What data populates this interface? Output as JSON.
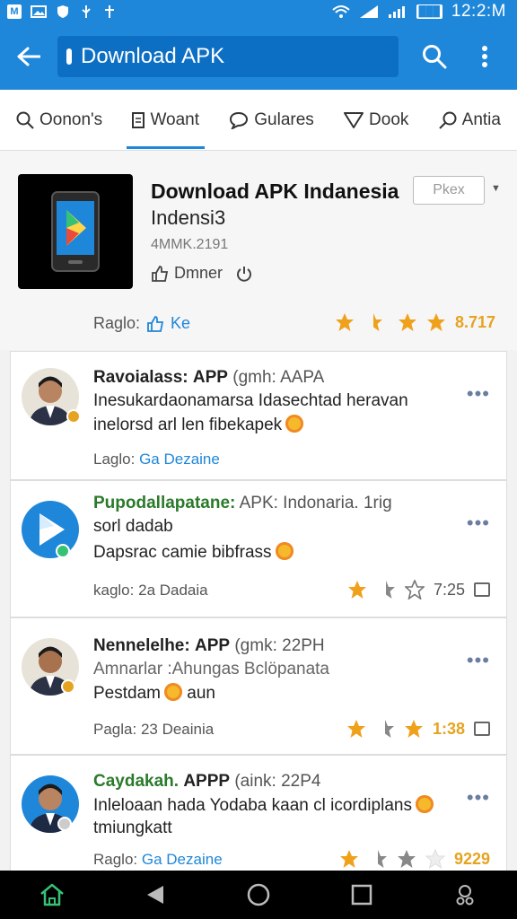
{
  "status_bar": {
    "left_icons": [
      "M",
      "img",
      "5",
      "usb",
      "+"
    ],
    "battery": "███",
    "time": "12:2:M"
  },
  "toolbar": {
    "search_text": "Download APK"
  },
  "tabs": [
    {
      "label": "Oonon's",
      "icon": "search-icon"
    },
    {
      "label": "Woant",
      "icon": "document-icon",
      "active": true
    },
    {
      "label": "Gulares",
      "icon": "chat-icon"
    },
    {
      "label": "Dook",
      "icon": "filter-icon"
    },
    {
      "label": "Antia",
      "icon": "search-icon"
    }
  ],
  "app": {
    "title": "Download APK Indanesia",
    "subtitle": "Indensi3",
    "date": "4MMK.2191",
    "action_label": "Dmner",
    "price_label": "Pkex",
    "rating_label": "Raglo:",
    "rating_value": "Ke",
    "score": "8.717",
    "accent_color": "#1f87d9",
    "star_color": "#f0a11c"
  },
  "posts": [
    {
      "author": "Ravoialass:",
      "app": "APP",
      "tag": "(gmh: AAPA",
      "line1": "Inesukardaonamarsa Idasechtad heravan",
      "line2": "inelorsd arl len fibekapek",
      "meta_label": "Laglo:",
      "meta_value": "Ga Dezaine"
    },
    {
      "author": "Pupodallapatane:",
      "app": "APK: Indonaria. 1rig",
      "tag": "",
      "line1": "sorl dadab",
      "line2": "Dapsrac camie bibfrass",
      "meta_label": "kaglo:",
      "meta_value": "2a Dadaia",
      "score": "7:25"
    },
    {
      "author": "Nennelelhe:",
      "app": "APP",
      "tag": "(gmk: 22PH",
      "line1": "Amnarlar :Ahungas Bclöpanata",
      "line2": "Pestdam",
      "line2_suffix": "aun",
      "meta_label": "Pagla:",
      "meta_value": "23 Deainia",
      "score": "1:38"
    },
    {
      "author": "Caydakah.",
      "app": "APPP",
      "tag": "(aink: 22P4",
      "line1": "Inleloaan hada Yodaba kaan cl icordiplans",
      "line2": "tmiungkatt",
      "meta_label": "Raglo:",
      "meta_value": "Ga Dezaine",
      "score": "9229"
    }
  ]
}
